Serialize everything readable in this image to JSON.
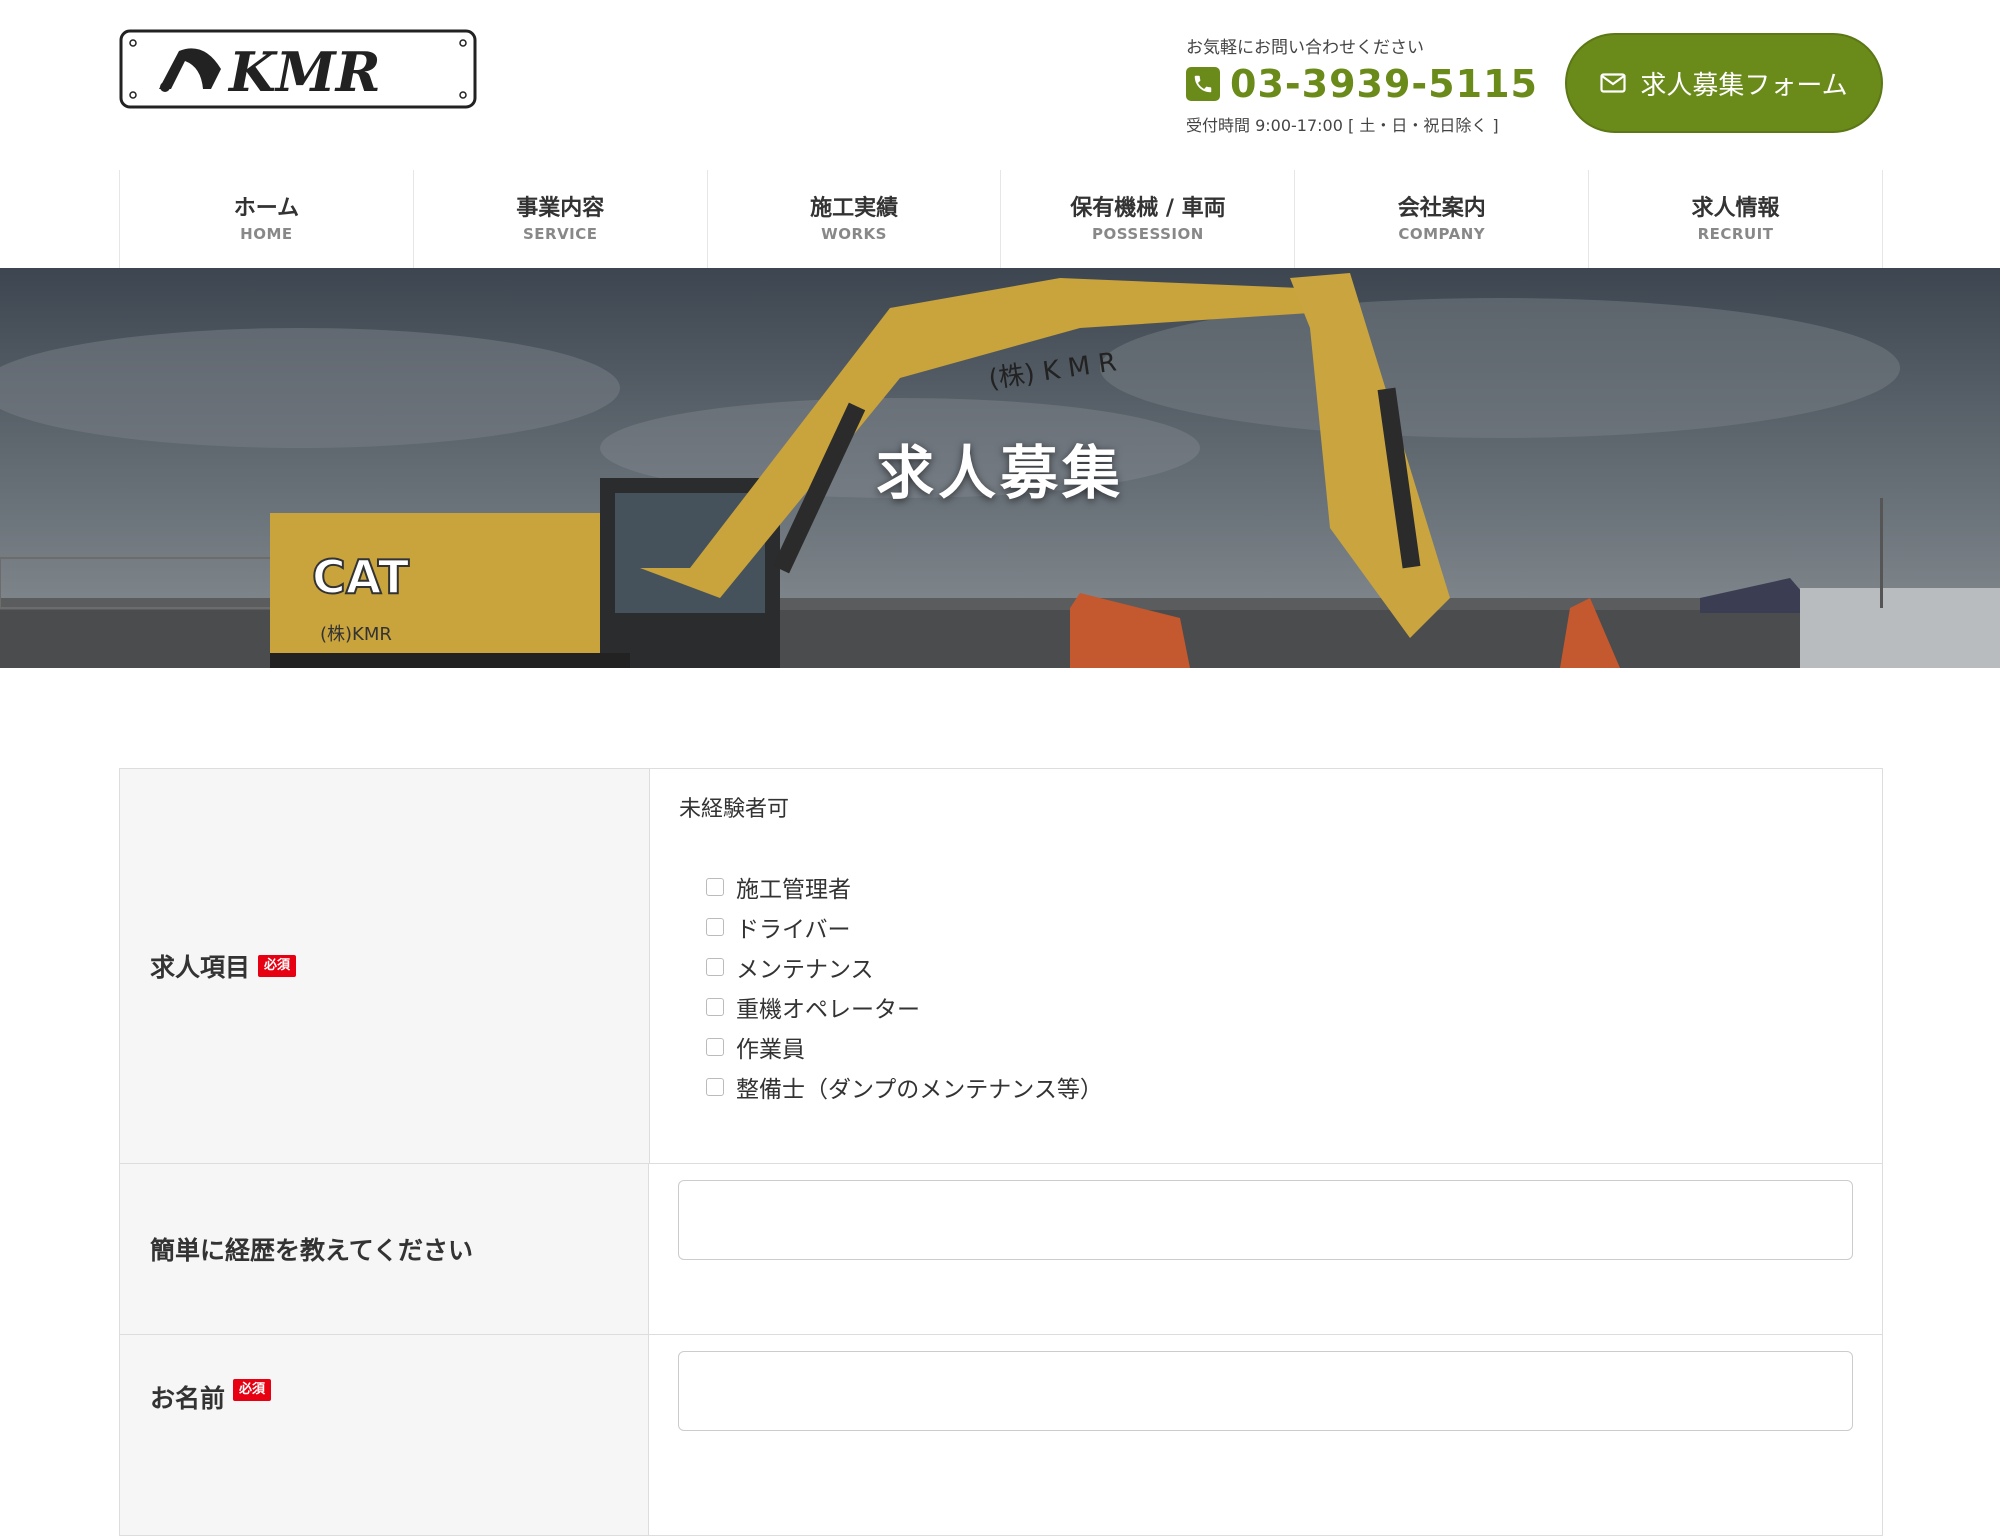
{
  "header": {
    "logo_text": "KMR",
    "contact_note": "お気軽にお問い合わせください",
    "phone_icon": "phone-icon",
    "phone_number": "03-3939-5115",
    "hours": "受付時間 9:00-17:00 [ 土・日・祝日除く ]",
    "recruit_button_icon": "mail-icon",
    "recruit_button_label": "求人募集フォーム",
    "accent_color": "#6a8a1a"
  },
  "nav": {
    "items": [
      {
        "jp": "ホーム",
        "en": "HOME"
      },
      {
        "jp": "事業内容",
        "en": "SERVICE"
      },
      {
        "jp": "施工実績",
        "en": "WORKS"
      },
      {
        "jp": "保有機械 / 車両",
        "en": "POSSESSION"
      },
      {
        "jp": "会社案内",
        "en": "COMPANY"
      },
      {
        "jp": "求人情報",
        "en": "RECRUIT"
      }
    ]
  },
  "hero": {
    "title": "求人募集",
    "photo_text_cab": "CAT",
    "photo_text_boom": "(株) K M R",
    "photo_text_side": "(株)KMR"
  },
  "form": {
    "required_badge": "必須",
    "rows": [
      {
        "label": "求人項目",
        "required": true,
        "note": "未経験者可",
        "options": [
          "施工管理者",
          "ドライバー",
          "メンテナンス",
          "重機オペレーター",
          "作業員",
          "整備士（ダンプのメンテナンス等）"
        ]
      },
      {
        "label": "簡単に経歴を教えてください",
        "required": false,
        "value": ""
      },
      {
        "label": "お名前",
        "required": true,
        "value": ""
      }
    ]
  }
}
